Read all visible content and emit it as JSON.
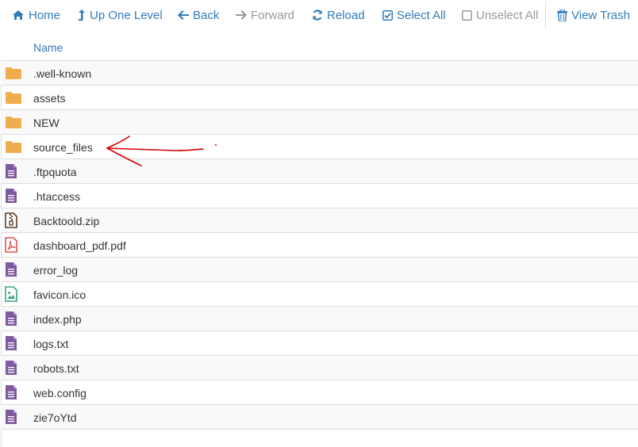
{
  "toolbar": {
    "home": "Home",
    "up": "Up One Level",
    "back": "Back",
    "forward": "Forward",
    "reload": "Reload",
    "select_all": "Select All",
    "unselect_all": "Unselect All",
    "view_trash": "View Trash"
  },
  "table": {
    "column_name": "Name"
  },
  "files": [
    {
      "name": ".well-known",
      "icon": "folder-icon"
    },
    {
      "name": "assets",
      "icon": "folder-icon"
    },
    {
      "name": "NEW",
      "icon": "folder-icon"
    },
    {
      "name": "source_files",
      "icon": "folder-icon"
    },
    {
      "name": ".ftpquota",
      "icon": "text-file-icon"
    },
    {
      "name": ".htaccess",
      "icon": "text-file-icon"
    },
    {
      "name": "Backtoold.zip",
      "icon": "zip-file-icon"
    },
    {
      "name": "dashboard_pdf.pdf",
      "icon": "pdf-file-icon"
    },
    {
      "name": "error_log",
      "icon": "text-file-icon"
    },
    {
      "name": "favicon.ico",
      "icon": "image-file-icon"
    },
    {
      "name": "index.php",
      "icon": "text-file-icon"
    },
    {
      "name": "logs.txt",
      "icon": "text-file-icon"
    },
    {
      "name": "robots.txt",
      "icon": "text-file-icon"
    },
    {
      "name": "web.config",
      "icon": "text-file-icon"
    },
    {
      "name": "zie7oYtd",
      "icon": "text-file-icon"
    }
  ],
  "colors": {
    "accent": "#337ab7",
    "disabled": "#999999",
    "folder": "#f0ad4e",
    "text_file": "#7e5aa0",
    "pdf": "#d9534f",
    "image": "#3aa67d",
    "annotation": "#d40000"
  }
}
